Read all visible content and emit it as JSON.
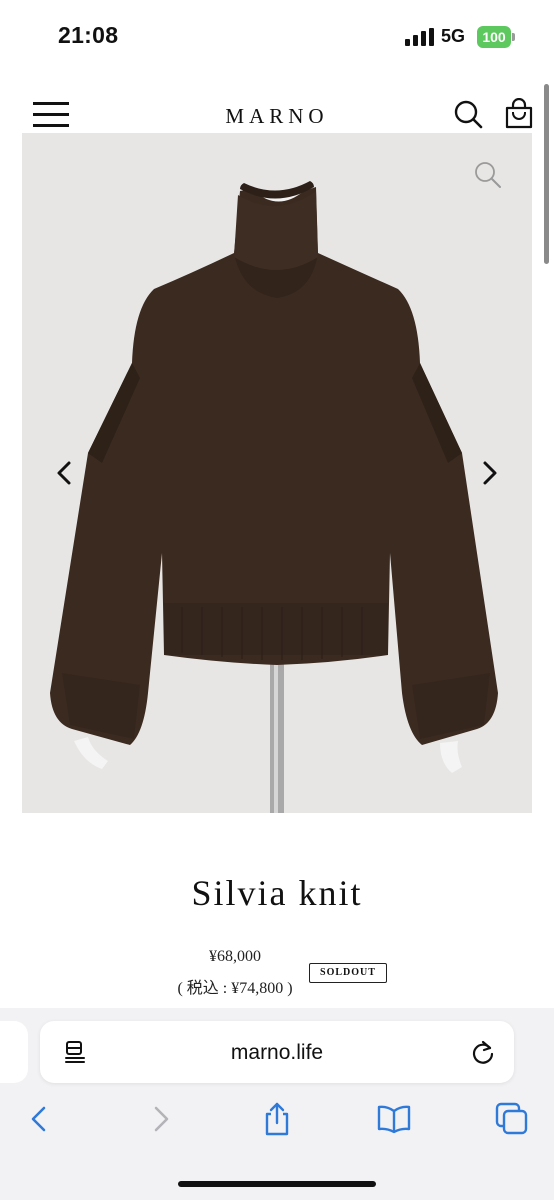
{
  "status_bar": {
    "time": "21:08",
    "network": "5G",
    "battery": "100",
    "battery_color": "#5cc85e"
  },
  "header": {
    "logo": "MARNO",
    "icons": [
      "menu-icon",
      "search-icon",
      "shopping-bag-icon"
    ]
  },
  "gallery": {
    "image": "brown-turtleneck-knit-sweater-on-mannequin",
    "background_color": "#e8e6e4",
    "icons": [
      "zoom-icon",
      "chevron-left-icon",
      "chevron-right-icon"
    ]
  },
  "product": {
    "name": "Silvia knit",
    "price": "¥68,000",
    "price_tax": "( 税込 : ¥74,800 )",
    "badge": "SOLDOUT"
  },
  "browser": {
    "url": "marno.life",
    "icons": [
      "reader-icon",
      "reload-icon",
      "back-icon",
      "forward-icon",
      "share-icon",
      "bookmarks-icon",
      "tabs-icon"
    ],
    "accent_color": "#2f7ad9"
  }
}
